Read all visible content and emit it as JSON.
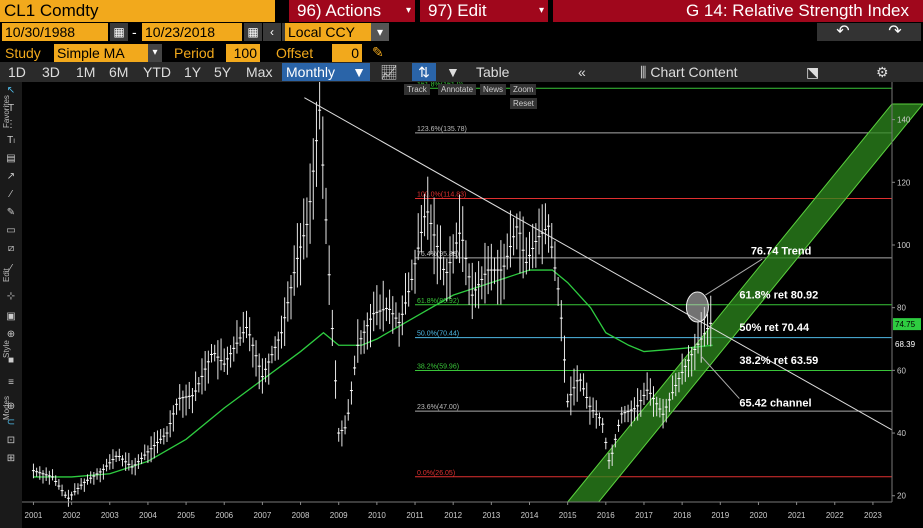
{
  "header": {
    "ticker": "CL1 Comdty",
    "actions_label": "96) Actions",
    "edit_label": "97) Edit",
    "title": "G 14: Relative Strength Index"
  },
  "range": {
    "start_date": "10/30/1988",
    "separator": "-",
    "end_date": "10/23/2018",
    "currency": "Local CCY"
  },
  "study": {
    "label": "Study",
    "value": "Simple MA",
    "period_label": "Period",
    "period_value": "100",
    "offset_label": "Offset",
    "offset_value": "0"
  },
  "toolbar": {
    "periods": [
      "1D",
      "3D",
      "1M",
      "6M",
      "YTD",
      "1Y",
      "5Y",
      "Max"
    ],
    "frequency": "Monthly",
    "table_label": "Table",
    "chart_content_label": "Chart Content"
  },
  "left_labels": {
    "favorites": "Favorites",
    "edit": "Edit",
    "style": "Style",
    "modes": "Modes"
  },
  "chart_tools": [
    "Track",
    "Annotate",
    "News",
    "Zoom",
    "Reset"
  ],
  "annotations": {
    "trend": "76.74 Trend",
    "ret618": "61.8% ret 80.92",
    "ret50": "50% ret 70.44",
    "ret382": "38.2% ret 63.59",
    "channel": "65.42 channel"
  },
  "fib_labels": {
    "f1618": "161.8%(161.0)",
    "f1236": "123.6%(135.78)",
    "f100": "100.0%(114.83)",
    "f764": "76.4%(95.88)",
    "f618": "61.8%(80.92)",
    "f50": "50.0%(70.44)",
    "f382": "38.2%(59.96)",
    "f236": "23.6%(47.00)",
    "f0": "0.0%(26.05)"
  },
  "price_tags": {
    "ma": "74.75",
    "last": "68.39"
  },
  "colors": {
    "bloomberg_orange": "#f2a91c",
    "action_red": "#a0071c",
    "ma_green": "#2ecc40",
    "channel_green": "#2d8a1e",
    "selected_blue": "#2a64a8"
  },
  "chart_data": {
    "type": "candlestick",
    "frequency": "monthly",
    "x_ticks": [
      "2001",
      "2002",
      "2003",
      "2004",
      "2005",
      "2006",
      "2007",
      "2008",
      "2009",
      "2010",
      "2011",
      "2012",
      "2013",
      "2014",
      "2015",
      "2016",
      "2017",
      "2018",
      "2019",
      "2020",
      "2021",
      "2022",
      "2023"
    ],
    "y_ticks": [
      20,
      40,
      60,
      80,
      100,
      120,
      140
    ],
    "ylim": [
      18,
      152
    ],
    "xlim": [
      2000.7,
      2023.5
    ],
    "price_path": [
      [
        2001.0,
        28
      ],
      [
        2001.5,
        26
      ],
      [
        2001.9,
        19
      ],
      [
        2002.3,
        24
      ],
      [
        2002.8,
        28
      ],
      [
        2003.2,
        33
      ],
      [
        2003.6,
        29
      ],
      [
        2004.0,
        34
      ],
      [
        2004.5,
        40
      ],
      [
        2004.8,
        51
      ],
      [
        2005.2,
        52
      ],
      [
        2005.7,
        66
      ],
      [
        2006.0,
        62
      ],
      [
        2006.6,
        74
      ],
      [
        2007.0,
        58
      ],
      [
        2007.5,
        72
      ],
      [
        2007.9,
        95
      ],
      [
        2008.2,
        108
      ],
      [
        2008.5,
        143
      ],
      [
        2008.8,
        80
      ],
      [
        2009.0,
        40
      ],
      [
        2009.2,
        42
      ],
      [
        2009.5,
        68
      ],
      [
        2009.9,
        78
      ],
      [
        2010.3,
        80
      ],
      [
        2010.6,
        75
      ],
      [
        2010.9,
        88
      ],
      [
        2011.3,
        112
      ],
      [
        2011.8,
        90
      ],
      [
        2012.2,
        105
      ],
      [
        2012.5,
        84
      ],
      [
        2012.9,
        92
      ],
      [
        2013.3,
        92
      ],
      [
        2013.7,
        107
      ],
      [
        2013.9,
        94
      ],
      [
        2014.2,
        102
      ],
      [
        2014.5,
        106
      ],
      [
        2014.8,
        82
      ],
      [
        2015.0,
        50
      ],
      [
        2015.3,
        58
      ],
      [
        2015.6,
        48
      ],
      [
        2015.9,
        44
      ],
      [
        2016.1,
        30
      ],
      [
        2016.4,
        46
      ],
      [
        2016.8,
        48
      ],
      [
        2017.1,
        54
      ],
      [
        2017.5,
        46
      ],
      [
        2017.9,
        57
      ],
      [
        2018.2,
        64
      ],
      [
        2018.5,
        70
      ],
      [
        2018.8,
        76
      ]
    ],
    "ma_path": [
      [
        2001.0,
        26
      ],
      [
        2002,
        26
      ],
      [
        2003,
        27
      ],
      [
        2004,
        31
      ],
      [
        2005,
        38
      ],
      [
        2006,
        48
      ],
      [
        2007,
        57
      ],
      [
        2008,
        66
      ],
      [
        2008.6,
        72
      ],
      [
        2009.0,
        68
      ],
      [
        2009.6,
        68
      ],
      [
        2010,
        70
      ],
      [
        2011,
        77
      ],
      [
        2012,
        84
      ],
      [
        2013,
        88
      ],
      [
        2014,
        92
      ],
      [
        2014.6,
        92
      ],
      [
        2015,
        88
      ],
      [
        2015.6,
        80
      ],
      [
        2016,
        72
      ],
      [
        2016.6,
        68
      ],
      [
        2017,
        66
      ],
      [
        2018,
        67
      ],
      [
        2018.8,
        68
      ]
    ],
    "fib_levels": [
      {
        "level": "161.8%",
        "value": 150.0,
        "color": "#39c539"
      },
      {
        "level": "123.6%",
        "value": 135.78,
        "color": "#aaaaaa"
      },
      {
        "level": "100.0%",
        "value": 114.83,
        "color": "#e03030"
      },
      {
        "level": "76.4%",
        "value": 95.88,
        "color": "#aaaaaa"
      },
      {
        "level": "61.8%",
        "value": 80.92,
        "color": "#39c539"
      },
      {
        "level": "50.0%",
        "value": 70.44,
        "color": "#4fb9e6"
      },
      {
        "level": "38.2%",
        "value": 59.96,
        "color": "#39c539"
      },
      {
        "level": "23.6%",
        "value": 47.0,
        "color": "#aaaaaa"
      },
      {
        "level": "0.0%",
        "value": 26.05,
        "color": "#e03030"
      }
    ],
    "trend_line": [
      [
        2008.1,
        147
      ],
      [
        2023.5,
        41
      ]
    ],
    "channel": {
      "start": [
        2015.0,
        18
      ],
      "end": [
        2023.5,
        145
      ],
      "width": 10
    }
  }
}
